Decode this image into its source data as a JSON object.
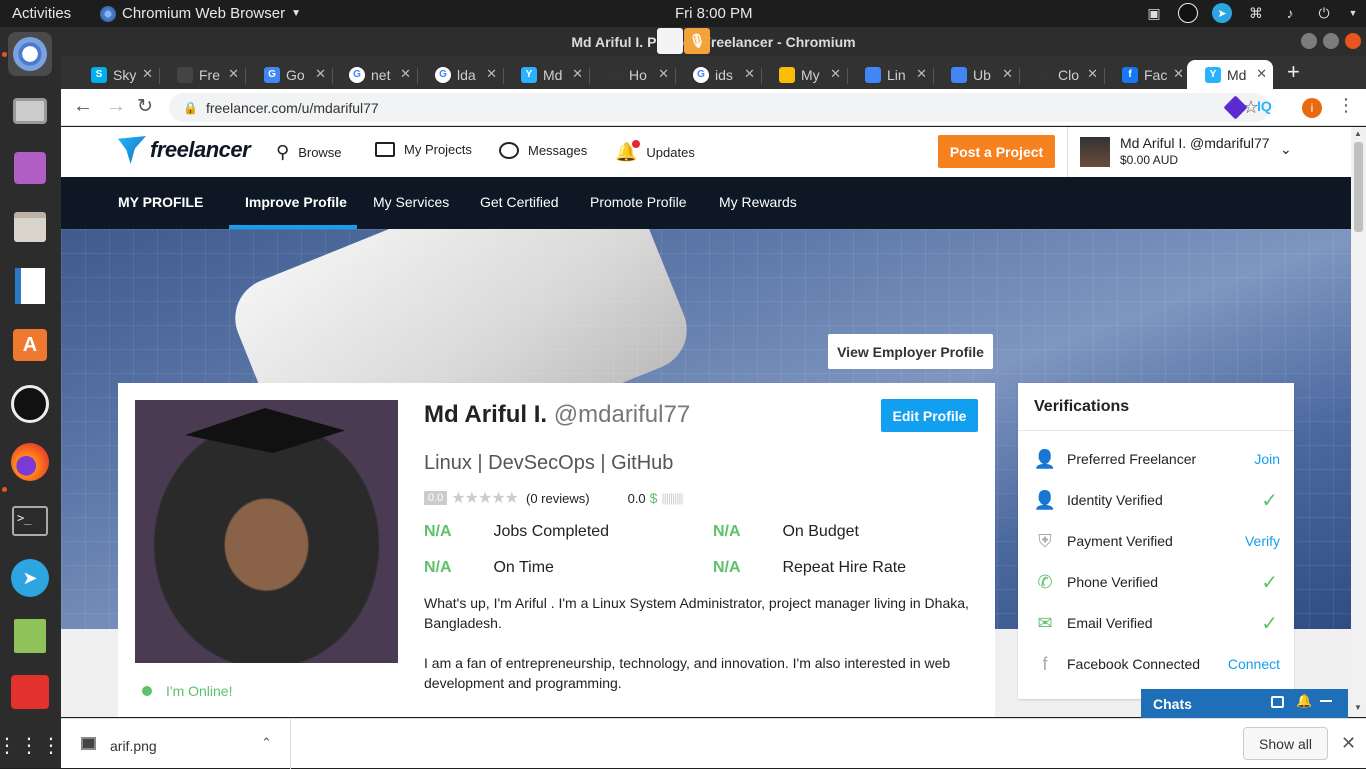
{
  "topbar": {
    "activities": "Activities",
    "app_name": "Chromium Web Browser",
    "clock": "Fri  8:00 PM"
  },
  "window": {
    "title": "Md Ariful I. Profile | Freelancer - Chromium"
  },
  "tabs": [
    {
      "label": "Sky",
      "icon": "skype-icon",
      "color": "#00aff0",
      "glyph": "S"
    },
    {
      "label": "Fre",
      "icon": "freelancer-icon",
      "color": "#444444",
      "glyph": ""
    },
    {
      "label": "Go",
      "icon": "google-translate-icon",
      "color": "#4285f4",
      "glyph": "G"
    },
    {
      "label": "net",
      "icon": "google-icon",
      "color": "#ffffff",
      "glyph": "G"
    },
    {
      "label": "lda",
      "icon": "google-icon",
      "color": "#ffffff",
      "glyph": "G"
    },
    {
      "label": "Md",
      "icon": "freelancer-icon",
      "color": "#29b2fe",
      "glyph": "Y"
    },
    {
      "label": "Ho",
      "icon": "github-icon",
      "color": "#333333",
      "glyph": ""
    },
    {
      "label": "ids",
      "icon": "google-icon",
      "color": "#ffffff",
      "glyph": "G"
    },
    {
      "label": "My",
      "icon": "google-drive-icon",
      "color": "#fbbc04",
      "glyph": ""
    },
    {
      "label": "Lin",
      "icon": "google-docs-icon",
      "color": "#4285f4",
      "glyph": ""
    },
    {
      "label": "Ub",
      "icon": "google-docs-icon",
      "color": "#4285f4",
      "glyph": ""
    },
    {
      "label": "Clo",
      "icon": "github-icon",
      "color": "#333333",
      "glyph": ""
    },
    {
      "label": "Fac",
      "icon": "facebook-icon",
      "color": "#1877f2",
      "glyph": "f"
    },
    {
      "label": "Md",
      "icon": "freelancer-icon",
      "color": "#29b2fe",
      "glyph": "Y",
      "active": true
    }
  ],
  "toolbar": {
    "url": "freelancer.com/u/mdariful77"
  },
  "fl_header": {
    "logo": "freelancer",
    "nav": [
      "Browse",
      "My Projects",
      "Messages",
      "Updates"
    ],
    "post_project": "Post a Project",
    "user_name": "Md Ariful I. @mdariful77",
    "balance": "$0.00 AUD"
  },
  "subnav": {
    "title": "MY PROFILE",
    "items": [
      "Improve Profile",
      "My Services",
      "Get Certified",
      "Promote Profile",
      "My Rewards"
    ],
    "active_item": "Improve Profile"
  },
  "banner": {
    "view_employer": "View Employer Profile"
  },
  "profile": {
    "name": "Md Ariful I.",
    "handle": "@mdariful77",
    "edit_button": "Edit Profile",
    "tagline": "Linux | DevSecOps | GitHub",
    "rating": "0.0",
    "reviews": "(0 reviews)",
    "earnings_score": "0.0",
    "online": "I'm Online!",
    "stats": [
      {
        "value": "N/A",
        "label": "Jobs Completed"
      },
      {
        "value": "N/A",
        "label": "On Budget"
      },
      {
        "value": "N/A",
        "label": "On Time"
      },
      {
        "value": "N/A",
        "label": "Repeat Hire Rate"
      }
    ],
    "bio_1": "What's up, I'm Ariful . I'm a Linux System Administrator, project manager living in Dhaka, Bangladesh.",
    "bio_2": "I am a fan of entrepreneurship, technology, and innovation. I'm also interested in web development and programming."
  },
  "verifications": {
    "title": "Verifications",
    "items": [
      {
        "label": "Preferred Freelancer",
        "action": "Join",
        "state": "link"
      },
      {
        "label": "Identity Verified",
        "action": "",
        "state": "check"
      },
      {
        "label": "Payment Verified",
        "action": "Verify",
        "state": "link"
      },
      {
        "label": "Phone Verified",
        "action": "",
        "state": "check"
      },
      {
        "label": "Email Verified",
        "action": "",
        "state": "check"
      },
      {
        "label": "Facebook Connected",
        "action": "Connect",
        "state": "link"
      }
    ]
  },
  "chats": {
    "label": "Chats"
  },
  "downloads": {
    "file": "arif.png",
    "show_all": "Show all"
  },
  "colors": {
    "accent_orange": "#f5821f",
    "fl_blue": "#139ff0",
    "dark_nav": "#0e1724",
    "green": "#5dc26a"
  }
}
